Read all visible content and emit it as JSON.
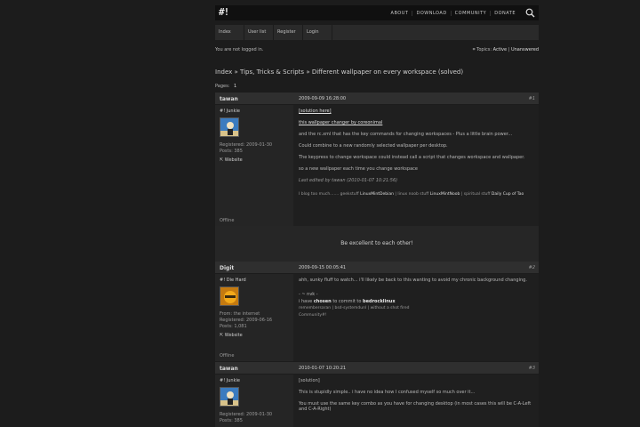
{
  "logo": "#!",
  "topnav": [
    "ABOUT",
    "DOWNLOAD",
    "COMMUNITY",
    "DONATE"
  ],
  "subnav": [
    "Index",
    "User list",
    "Register",
    "Login"
  ],
  "status": {
    "left": "You are not logged in.",
    "topics_label": "Topics:",
    "active": "Active",
    "unanswered": "Unanswered"
  },
  "breadcrumb": {
    "index": "Index",
    "sep": "»",
    "forum": "Tips, Tricks & Scripts",
    "topic": "Different wallpaper on every workspace (solved)"
  },
  "pages": {
    "label": "Pages:",
    "current": "1"
  },
  "posts": [
    {
      "author": "tawan",
      "date": "2009-09-09 16:28:00",
      "num": "#1",
      "title": "#! Junkie",
      "registered": "Registered: 2009-01-30",
      "posts": "Posts: 385",
      "website": "Website",
      "status": "Offline",
      "lines": [
        "[solution here]",
        "this wallpaper changer by coreonimal",
        "and the rc.xml that has the key commands for changing workspaces - Plus a little brain power...",
        "Could combine to a new randomly selected wallpaper per desktop.",
        "The keypress to change workspace could instead call a script that changes workspace and wallpaper.",
        "so a new wallpaper each time you change workspace",
        "Last edited by tawan (2010-01-07 10:21:56)"
      ],
      "sig": {
        "a": "I blog too much.......",
        "b": "geekstuff",
        "c": "LinuxMintDebian",
        "d": "| linux noob stuff",
        "e": "LinuxMintNoob",
        "f": "| spiritual stuff",
        "g": "Daily Cup of Tao"
      }
    },
    {
      "author": "Digit",
      "date": "2009-09-15 00:05:41",
      "num": "#2",
      "title": "#! Die Hard",
      "from": "From: the internet",
      "registered": "Registered: 2009-06-16",
      "posts": "Posts: 1,081",
      "website": "Website",
      "status": "Offline",
      "lines": [
        "ahh, sunky fluff to watch... i'll likely be back to this wanting to avoid my chronic background changing.",
        "- ~ nvk -",
        "i have",
        "chosen",
        "to commit to",
        "bedrocklinux",
        "remembersaran | bsd-systemdunl | without a shot fired",
        "Community#!"
      ]
    },
    {
      "author": "tawan",
      "date": "2010-01-07 10:20:21",
      "num": "#3",
      "title": "#! Junkie",
      "registered": "Registered: 2009-01-30",
      "posts": "Posts: 385",
      "lines": [
        "[solution]",
        "This is stupidly simple.. i have no idea how I confused myself so much over it...",
        "You must use the same key combo as you have for changing desktop (in most cases this will be C-A-Left and C-A-Right)"
      ]
    }
  ],
  "banner": "Be excellent to each other!"
}
